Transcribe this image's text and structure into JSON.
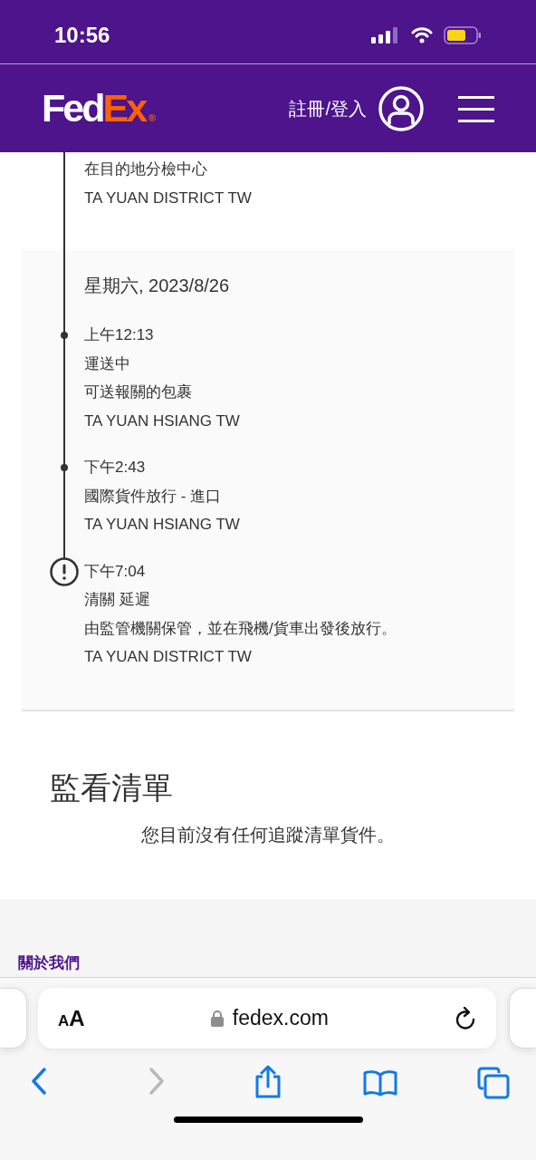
{
  "status_bar": {
    "time": "10:56"
  },
  "header": {
    "logo": {
      "left": "Fed",
      "right": "Ex",
      "mark": "®"
    },
    "sign_in": "註冊/登入"
  },
  "tracking": {
    "partial_event": {
      "lines": [
        "在目的地分檢中心",
        "TA YUAN DISTRICT TW"
      ]
    },
    "day": {
      "date": "星期六, 2023/8/26",
      "events": [
        {
          "kind": "dot",
          "time": "上午12:13",
          "lines": [
            "運送中",
            "可送報關的包裹",
            "TA YUAN HSIANG TW"
          ]
        },
        {
          "kind": "dot",
          "time": "下午2:43",
          "lines": [
            "國際貨件放行 - 進口",
            "TA YUAN HSIANG TW"
          ]
        },
        {
          "kind": "alert",
          "time": "下午7:04",
          "lines": [
            "清關 延遲",
            "由監管機關保管，並在飛機/貨車出發後放行。",
            "TA YUAN DISTRICT TW"
          ]
        }
      ]
    }
  },
  "watch_list": {
    "title": "監看清單",
    "empty_message": "您目前沒有任何追蹤清單貨件。"
  },
  "footer": {
    "link": "關於我們"
  },
  "browser": {
    "text_size_label": "AA",
    "url": "fedex.com",
    "back_disabled": false,
    "forward_disabled": true
  }
}
